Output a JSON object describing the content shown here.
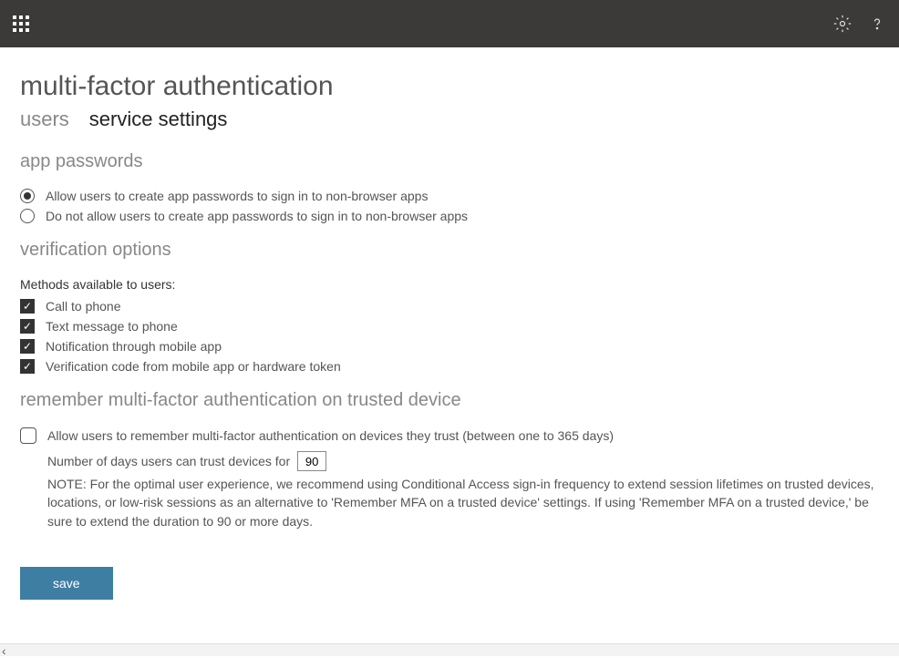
{
  "header": {
    "title": "multi-factor authentication"
  },
  "tabs": {
    "users": "users",
    "service_settings": "service settings"
  },
  "sections": {
    "app_passwords": {
      "title": "app passwords",
      "options": {
        "allow": "Allow users to create app passwords to sign in to non-browser apps",
        "disallow": "Do not allow users to create app passwords to sign in to non-browser apps"
      },
      "selected": "allow"
    },
    "verification_options": {
      "title": "verification options",
      "methods_label": "Methods available to users:",
      "methods": {
        "call": {
          "label": "Call to phone",
          "checked": true
        },
        "text": {
          "label": "Text message to phone",
          "checked": true
        },
        "notification": {
          "label": "Notification through mobile app",
          "checked": true
        },
        "code": {
          "label": "Verification code from mobile app or hardware token",
          "checked": true
        }
      }
    },
    "remember_mfa": {
      "title": "remember multi-factor authentication on trusted device",
      "allow_label": "Allow users to remember multi-factor authentication on devices they trust (between one to 365 days)",
      "allow_checked": false,
      "days_label": "Number of days users can trust devices for",
      "days_value": "90",
      "note": "NOTE: For the optimal user experience, we recommend using Conditional Access sign-in frequency to extend session lifetimes on trusted devices, locations, or low-risk sessions as an alternative to 'Remember MFA on a trusted device' settings. If using 'Remember MFA on a trusted device,' be sure to extend the duration to 90 or more days."
    }
  },
  "buttons": {
    "save": "save"
  }
}
